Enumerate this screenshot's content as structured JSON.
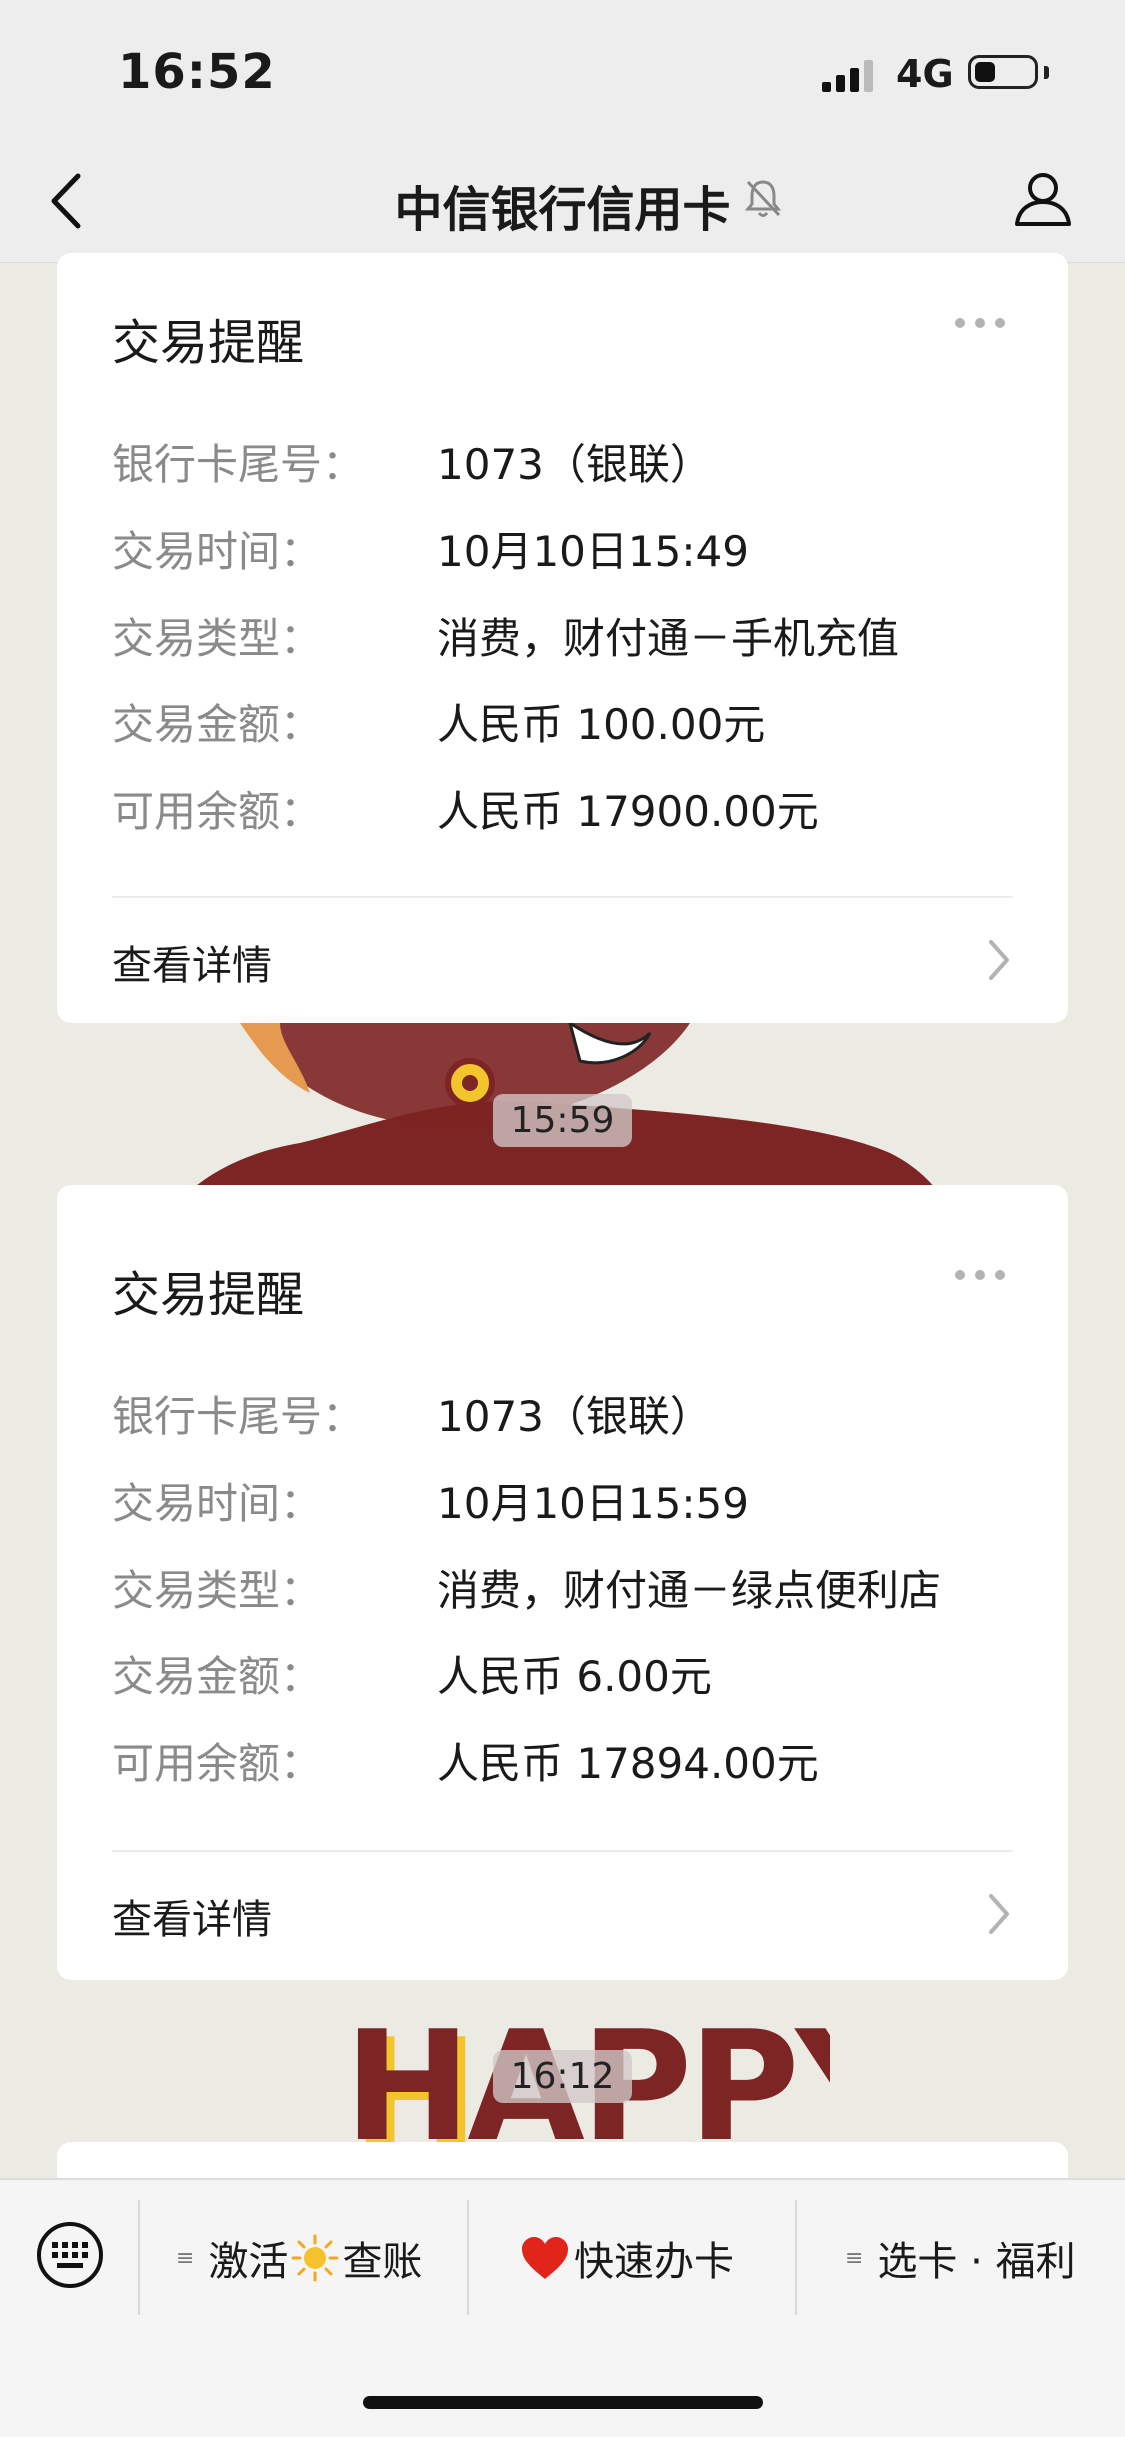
{
  "status_bar": {
    "time": "16:52",
    "network": "4G",
    "battery_level": 0.35
  },
  "nav": {
    "title": "中信银行信用卡"
  },
  "labels": {
    "card_no": "银行卡尾号：",
    "tx_time": "交易时间：",
    "tx_type": "交易类型：",
    "tx_amount": "交易金额：",
    "balance": "可用余额："
  },
  "messages": [
    {
      "title": "交易提醒",
      "card_no": "1073（银联）",
      "tx_time": "10月10日15:49",
      "tx_type": "消费，财付通－手机充值",
      "tx_amount": "人民币 100.00元",
      "balance": "人民币 17900.00元",
      "detail_link": "查看详情"
    },
    {
      "title": "交易提醒",
      "card_no": "1073（银联）",
      "tx_time": "10月10日15:59",
      "tx_type": "消费，财付通－绿点便利店",
      "tx_amount": "人民币 6.00元",
      "balance": "人民币 17894.00元",
      "detail_link": "查看详情"
    }
  ],
  "timestamps": [
    "15:59",
    "16:12"
  ],
  "stickers": {
    "happy_text": "HAPPY"
  },
  "bottom_menu": {
    "item1_part1": "激活",
    "item1_part2": "查账",
    "item2": "快速办卡",
    "item3": "选卡 · 福利",
    "lines_glyph": "≡"
  },
  "colors": {
    "sticker_red": "#7d2524",
    "happy_yellow": "#f3c52d",
    "accent": "#e1251b"
  }
}
